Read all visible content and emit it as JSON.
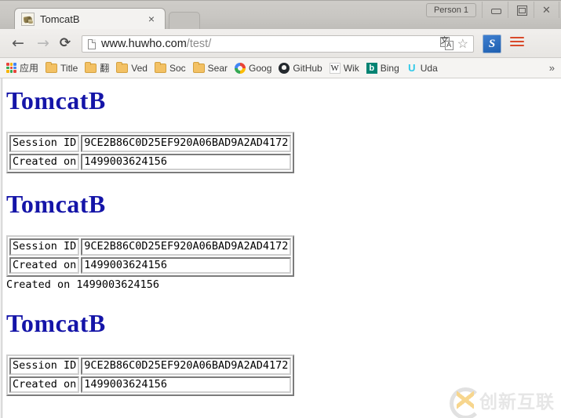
{
  "window": {
    "person_button": "Person 1",
    "minimize": "minimize",
    "maximize": "maximize",
    "close": "close"
  },
  "tab": {
    "title": "TomcatB",
    "close_glyph": "×",
    "favicon_name": "tomcat-favicon"
  },
  "toolbar": {
    "back_glyph": "←",
    "forward_glyph": "→",
    "reload_glyph": "⟳",
    "url_host": "www.huwho.com",
    "url_path": "/test/",
    "url_full": "www.huwho.com/test/",
    "star_glyph": "☆",
    "extension_label": "S",
    "translate_icon": "translate-icon",
    "menu_icon": "menu-icon"
  },
  "bookmarks": {
    "items": [
      {
        "label": "应用",
        "icon": "apps-grid-icon"
      },
      {
        "label": "Title",
        "icon": "folder-icon"
      },
      {
        "label": "翻",
        "icon": "folder-icon"
      },
      {
        "label": "Ved",
        "icon": "folder-icon"
      },
      {
        "label": "Soc",
        "icon": "folder-icon"
      },
      {
        "label": "Sear",
        "icon": "folder-icon"
      },
      {
        "label": "Goog",
        "icon": "google-icon"
      },
      {
        "label": "GitHub",
        "icon": "github-icon"
      },
      {
        "label": "Wik",
        "icon": "wikipedia-icon"
      },
      {
        "label": "Bing",
        "icon": "bing-icon"
      },
      {
        "label": "Uda",
        "icon": "udacity-icon"
      }
    ],
    "overflow_glyph": "»"
  },
  "page": {
    "blocks": [
      {
        "heading": "TomcatB",
        "rows": [
          {
            "key": "Session ID",
            "value": "9CE2B86C0D25EF920A06BAD9A2AD4172"
          },
          {
            "key": "Created on",
            "value": "1499003624156"
          }
        ],
        "extra_line": ""
      },
      {
        "heading": "TomcatB",
        "rows": [
          {
            "key": "Session ID",
            "value": "9CE2B86C0D25EF920A06BAD9A2AD4172"
          },
          {
            "key": "Created on",
            "value": "1499003624156"
          }
        ],
        "extra_line": "Created on 1499003624156"
      },
      {
        "heading": "TomcatB",
        "rows": [
          {
            "key": "Session ID",
            "value": "9CE2B86C0D25EF920A06BAD9A2AD4172"
          },
          {
            "key": "Created on",
            "value": "1499003624156"
          }
        ],
        "extra_line": ""
      }
    ],
    "heading_color": "#1515a8"
  },
  "watermark": {
    "text": "创新互联"
  }
}
